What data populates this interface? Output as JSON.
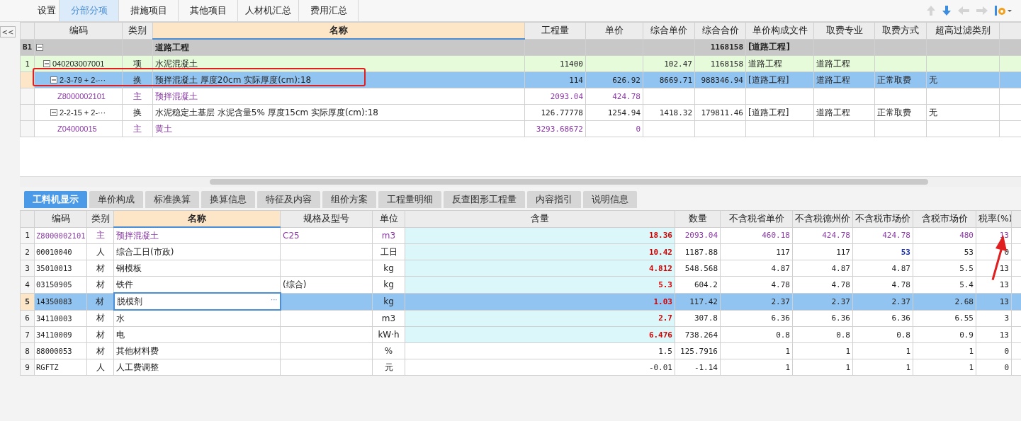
{
  "top_tabs": [
    {
      "label": "设置",
      "selected": false
    },
    {
      "label": "分部分项",
      "selected": true
    },
    {
      "label": "措施项目",
      "selected": false
    },
    {
      "label": "其他项目",
      "selected": false
    },
    {
      "label": "人材机汇总",
      "selected": false
    },
    {
      "label": "费用汇总",
      "selected": false
    }
  ],
  "sidebar": {
    "collapse_button": "<<"
  },
  "top_table": {
    "columns": [
      "编码",
      "类别",
      "名称",
      "工程量",
      "单价",
      "综合单价",
      "综合合价",
      "单价构成文件",
      "取费专业",
      "取费方式",
      "超高过滤类别"
    ],
    "rows": [
      {
        "kind": "group",
        "number": "B1",
        "expanded": true,
        "selected": false,
        "name": "道路工程",
        "comp_total": "1168158",
        "price_file": "[道路工程]",
        "children": [
          {
            "kind": "item",
            "number": "1",
            "expanded": true,
            "selected": false,
            "code": "040203007001",
            "type": "项",
            "name": "水泥混凝土",
            "quantity": "11400",
            "comp_unit_price": "102.47",
            "comp_total": "1168158",
            "price_file": "道路工程",
            "fee_specialty": "道路工程",
            "children": [
              {
                "kind": "sub",
                "expanded": true,
                "selected": true,
                "code": "2-3-79 + 2-···",
                "type": "换",
                "name": "预拌混凝土 厚度20cm  实际厚度(cm):18",
                "quantity": "114",
                "unit_price": "626.92",
                "comp_unit_price": "8669.71",
                "comp_total": "988346.94",
                "price_file": "[道路工程]",
                "fee_specialty": "道路工程",
                "fee_method": "正常取费",
                "filter_type": "无",
                "children": [
                  {
                    "kind": "material",
                    "selected": false,
                    "code": "Z8000002101",
                    "type": "主",
                    "name": "预拌混凝土",
                    "quantity": "2093.04",
                    "unit_price": "424.78"
                  }
                ]
              },
              {
                "kind": "sub",
                "expanded": true,
                "selected": false,
                "code": "2-2-15 + 2-···",
                "type": "换",
                "name": "水泥稳定土基层 水泥含量5% 厚度15cm  实际厚度(cm):18",
                "quantity": "126.77778",
                "unit_price": "1254.94",
                "comp_unit_price": "1418.32",
                "comp_total": "179811.46",
                "price_file": "[道路工程]",
                "fee_specialty": "道路工程",
                "fee_method": "正常取费",
                "filter_type": "无",
                "children": [
                  {
                    "kind": "material",
                    "selected": false,
                    "code": "Z04000015",
                    "type": "主",
                    "name": "黄土",
                    "quantity": "3293.68672",
                    "unit_price": "0"
                  }
                ]
              }
            ]
          }
        ]
      }
    ]
  },
  "bottom_tabs": [
    {
      "label": "工料机显示",
      "selected": true
    },
    {
      "label": "单价构成",
      "selected": false
    },
    {
      "label": "标准换算",
      "selected": false
    },
    {
      "label": "换算信息",
      "selected": false
    },
    {
      "label": "特征及内容",
      "selected": false
    },
    {
      "label": "组价方案",
      "selected": false
    },
    {
      "label": "工程量明细",
      "selected": false
    },
    {
      "label": "反查图形工程量",
      "selected": false
    },
    {
      "label": "内容指引",
      "selected": false
    },
    {
      "label": "说明信息",
      "selected": false
    }
  ],
  "bottom_table": {
    "edit_button": "···",
    "columns": [
      "编码",
      "类别",
      "名称",
      "规格及型号",
      "单位",
      "含量",
      "数量",
      "不含税省单价",
      "不含税德州价",
      "不含税市场价",
      "含税市场价",
      "税率(%)"
    ],
    "rows": [
      {
        "kind": "main",
        "selected": false,
        "number": "1",
        "code": "Z8000002101",
        "type": "主",
        "name": "预拌混凝土",
        "spec": "C25",
        "unit": "m3",
        "content": "18.36",
        "amount": "2093.04",
        "prov_price": "460.18",
        "city_price": "424.78",
        "market_price": "424.78",
        "market_adjusted": false,
        "taxed_price": "480",
        "tax_rate": "13"
      },
      {
        "kind": "resource",
        "selected": false,
        "number": "2",
        "code": "00010040",
        "type": "人",
        "name": "综合工日(市政)",
        "unit": "工日",
        "content": "10.42",
        "amount": "1187.88",
        "prov_price": "117",
        "city_price": "117",
        "market_price": "53",
        "market_adjusted": true,
        "taxed_price": "53",
        "tax_rate": "0"
      },
      {
        "kind": "resource",
        "selected": false,
        "number": "3",
        "code": "35010013",
        "type": "材",
        "name": "钢模板",
        "unit": "kg",
        "content": "4.812",
        "amount": "548.568",
        "prov_price": "4.87",
        "city_price": "4.87",
        "market_price": "4.87",
        "market_adjusted": false,
        "taxed_price": "5.5",
        "tax_rate": "13"
      },
      {
        "kind": "resource",
        "selected": false,
        "number": "4",
        "code": "03150905",
        "type": "材",
        "name": "铁件",
        "spec": "(综合)",
        "unit": "kg",
        "content": "5.3",
        "amount": "604.2",
        "prov_price": "4.78",
        "city_price": "4.78",
        "market_price": "4.78",
        "market_adjusted": false,
        "taxed_price": "5.4",
        "tax_rate": "13"
      },
      {
        "kind": "resource",
        "selected": true,
        "number": "5",
        "code": "14350083",
        "type": "材",
        "name": "脱模剂",
        "unit": "kg",
        "content": "1.03",
        "amount": "117.42",
        "prov_price": "2.37",
        "city_price": "2.37",
        "market_price": "2.37",
        "market_adjusted": false,
        "taxed_price": "2.68",
        "tax_rate": "13"
      },
      {
        "kind": "resource",
        "selected": false,
        "number": "6",
        "code": "34110003",
        "type": "材",
        "name": "水",
        "unit": "m3",
        "content": "2.7",
        "amount": "307.8",
        "prov_price": "6.36",
        "city_price": "6.36",
        "market_price": "6.36",
        "market_adjusted": false,
        "taxed_price": "6.55",
        "tax_rate": "3"
      },
      {
        "kind": "resource",
        "selected": false,
        "number": "7",
        "code": "34110009",
        "type": "材",
        "name": "电",
        "unit": "kW·h",
        "content": "6.476",
        "amount": "738.264",
        "prov_price": "0.8",
        "city_price": "0.8",
        "market_price": "0.8",
        "market_adjusted": false,
        "taxed_price": "0.9",
        "tax_rate": "13"
      },
      {
        "kind": "fee",
        "selected": false,
        "number": "8",
        "code": "88000053",
        "type": "材",
        "name": "其他材料费",
        "unit": "%",
        "content": "1.5",
        "amount": "125.7916",
        "prov_price": "1",
        "city_price": "1",
        "market_price": "1",
        "market_adjusted": false,
        "taxed_price": "1",
        "tax_rate": "0"
      },
      {
        "kind": "fee",
        "selected": false,
        "number": "9",
        "code": "RGFTZ",
        "type": "人",
        "name": "人工费调整",
        "unit": "元",
        "content": "-0.01",
        "amount": "-1.14",
        "prov_price": "1",
        "city_price": "1",
        "market_price": "1",
        "market_adjusted": false,
        "taxed_price": "1",
        "tax_rate": "0"
      }
    ]
  }
}
